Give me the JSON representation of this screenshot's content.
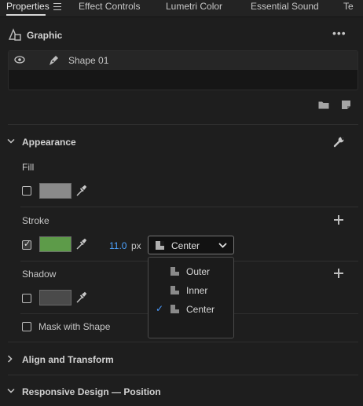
{
  "tabs": [
    {
      "label": "Properties"
    },
    {
      "label": "Effect Controls"
    },
    {
      "label": "Lumetri Color"
    },
    {
      "label": "Essential Sound"
    },
    {
      "label": "Te"
    }
  ],
  "graphic": {
    "title": "Graphic",
    "layer_name": "Shape 01"
  },
  "appearance": {
    "title": "Appearance",
    "fill": {
      "label": "Fill",
      "color": "#8a8a8a",
      "checked": false
    },
    "stroke": {
      "label": "Stroke",
      "color": "#5d9b49",
      "checked": true,
      "width": "11.0",
      "unit": "px",
      "position": "Center"
    },
    "shadow": {
      "label": "Shadow",
      "color": "#4a4a4a",
      "checked": false
    },
    "mask_label": "Mask with Shape"
  },
  "dropdown": {
    "options": [
      {
        "label": "Outer",
        "selected": false
      },
      {
        "label": "Inner",
        "selected": false
      },
      {
        "label": "Center",
        "selected": true
      }
    ],
    "check_mark": "✓"
  },
  "sections": {
    "align_transform": "Align and Transform",
    "responsive_design": "Responsive Design — Position"
  },
  "colors": {
    "accent_blue": "#4da3ff",
    "background": "#1e1e1e"
  }
}
